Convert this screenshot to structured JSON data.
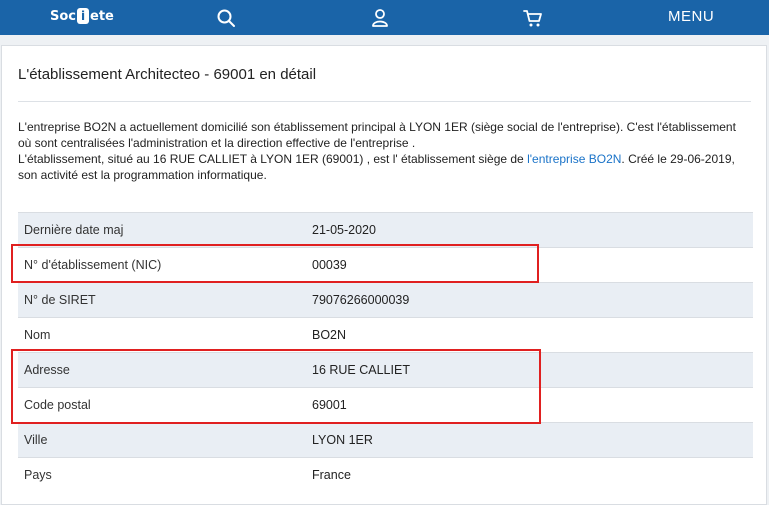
{
  "header": {
    "logo_pre": "Soc",
    "logo_mid": "i",
    "logo_post": "ete",
    "menu_label": "MENU",
    "icons": [
      "search-icon",
      "user-icon",
      "cart-icon"
    ]
  },
  "page": {
    "title": "L'établissement Architecteo - 69001 en détail",
    "intro": {
      "p1": "L'entreprise BO2N a actuellement domicilié son établissement principal à LYON 1ER (siège social de l'entreprise). C'est l'établissement où sont centralisées l'administration et la direction effective de l'entreprise .",
      "p2_before": "L'établissement, situé au 16 RUE CALLIET à LYON 1ER (69001) , est l' établissement siège de ",
      "p2_link": "l'entreprise BO2N",
      "p2_after": ". Créé le 29-06-2019, son activité est la programmation informatique."
    }
  },
  "details": [
    {
      "label": "Dernière date maj",
      "value": "21-05-2020"
    },
    {
      "label": "N° d'établissement (NIC)",
      "value": "00039"
    },
    {
      "label": "N° de SIRET",
      "value": "79076266000039"
    },
    {
      "label": "Nom",
      "value": "BO2N"
    },
    {
      "label": "Adresse",
      "value": "16 RUE CALLIET"
    },
    {
      "label": "Code postal",
      "value": "69001"
    },
    {
      "label": "Ville",
      "value": "LYON 1ER"
    },
    {
      "label": "Pays",
      "value": "France"
    }
  ],
  "colors": {
    "header_bg": "#1a64a8",
    "link": "#1a73c8",
    "highlight_border": "#e02020"
  }
}
